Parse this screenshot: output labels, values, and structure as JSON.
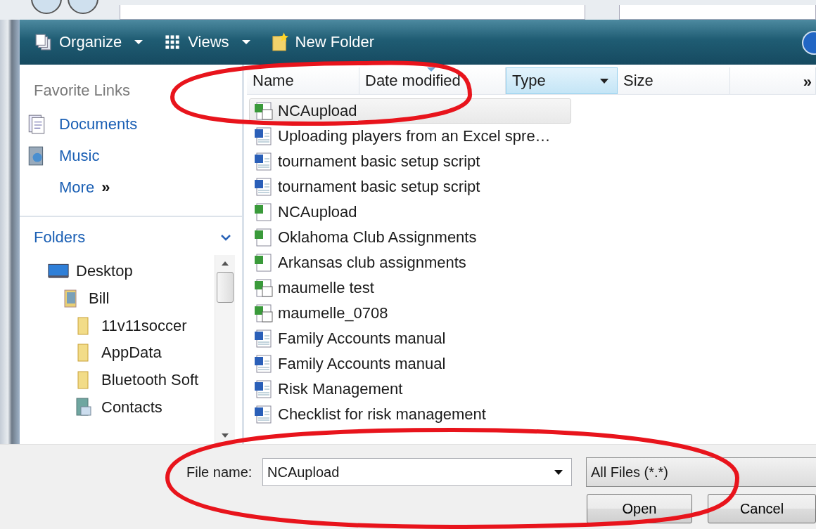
{
  "toolbar": {
    "buttons": [
      {
        "label": "Organize",
        "kind": "organize",
        "dropdown": true
      },
      {
        "label": "Views",
        "kind": "views",
        "dropdown": true
      },
      {
        "label": "New Folder",
        "kind": "new-folder",
        "dropdown": false
      }
    ]
  },
  "favorite_links": {
    "title": "Favorite Links",
    "items": [
      {
        "label": "Documents",
        "kind": "documents"
      },
      {
        "label": "Music",
        "kind": "music"
      },
      {
        "label": "More",
        "kind": "more",
        "glyph": "»"
      }
    ]
  },
  "folders": {
    "title": "Folders",
    "expanded": true,
    "tree": [
      {
        "label": "Desktop",
        "kind": "desktop",
        "children": [
          {
            "label": "Bill",
            "kind": "user",
            "children": [
              {
                "label": "11v11soccer",
                "kind": "folder"
              },
              {
                "label": "AppData",
                "kind": "folder"
              },
              {
                "label": "Bluetooth Soft",
                "kind": "folder"
              },
              {
                "label": "Contacts",
                "kind": "contacts"
              }
            ]
          }
        ]
      }
    ]
  },
  "columns": [
    {
      "label": "Name",
      "sorted": false,
      "highlighted": false
    },
    {
      "label": "Date modified",
      "sorted": true,
      "highlighted": false
    },
    {
      "label": "Type",
      "sorted": false,
      "highlighted": true
    },
    {
      "label": "Size",
      "sorted": false,
      "highlighted": false
    }
  ],
  "more_columns": "»",
  "files": [
    {
      "name": "NCAupload",
      "kind": "excel-a",
      "selected": true
    },
    {
      "name": "Uploading players from an Excel spre…",
      "kind": "word",
      "selected": false
    },
    {
      "name": "tournament basic setup script",
      "kind": "word",
      "selected": false
    },
    {
      "name": "tournament basic setup script",
      "kind": "word",
      "selected": false
    },
    {
      "name": "NCAupload",
      "kind": "excel",
      "selected": false
    },
    {
      "name": "Oklahoma Club Assignments",
      "kind": "excel",
      "selected": false
    },
    {
      "name": "Arkansas club assignments",
      "kind": "excel",
      "selected": false
    },
    {
      "name": "maumelle test",
      "kind": "excel-a",
      "selected": false
    },
    {
      "name": "maumelle_0708",
      "kind": "excel-a",
      "selected": false
    },
    {
      "name": "Family Accounts manual",
      "kind": "word",
      "selected": false
    },
    {
      "name": "Family Accounts manual",
      "kind": "word",
      "selected": false
    },
    {
      "name": "Risk Management",
      "kind": "word",
      "selected": false
    },
    {
      "name": "Checklist for risk management",
      "kind": "word",
      "selected": false
    }
  ],
  "file_name": {
    "label": "File name:",
    "value": "NCAupload"
  },
  "file_type": {
    "value": "All Files (*.*)"
  },
  "buttons": [
    "Open",
    "Cancel"
  ],
  "annotations": [
    {
      "kind": "ellipse"
    },
    {
      "kind": "ellipse"
    }
  ]
}
